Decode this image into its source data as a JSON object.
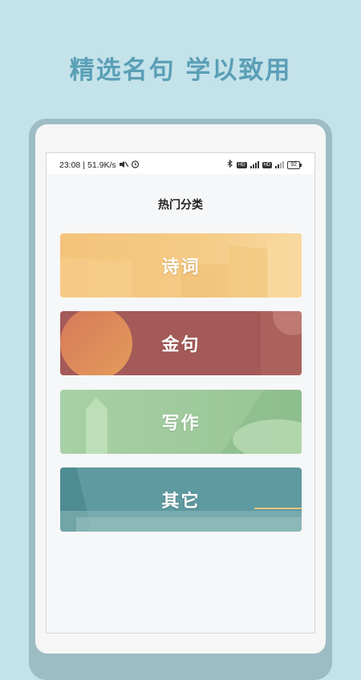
{
  "headline": "精选名句 学以致用",
  "status_bar": {
    "time": "23:08",
    "speed": "51.9K/s",
    "battery": "92",
    "net_label_1": "5G",
    "net_label_2": "4G",
    "hd_label": "HD"
  },
  "section_title": "热门分类",
  "categories": [
    {
      "label": "诗词",
      "color": "#f5c57d"
    },
    {
      "label": "金句",
      "color": "#a45a58"
    },
    {
      "label": "写作",
      "color": "#9ecb9b"
    },
    {
      "label": "其它",
      "color": "#5e9aa0"
    }
  ]
}
